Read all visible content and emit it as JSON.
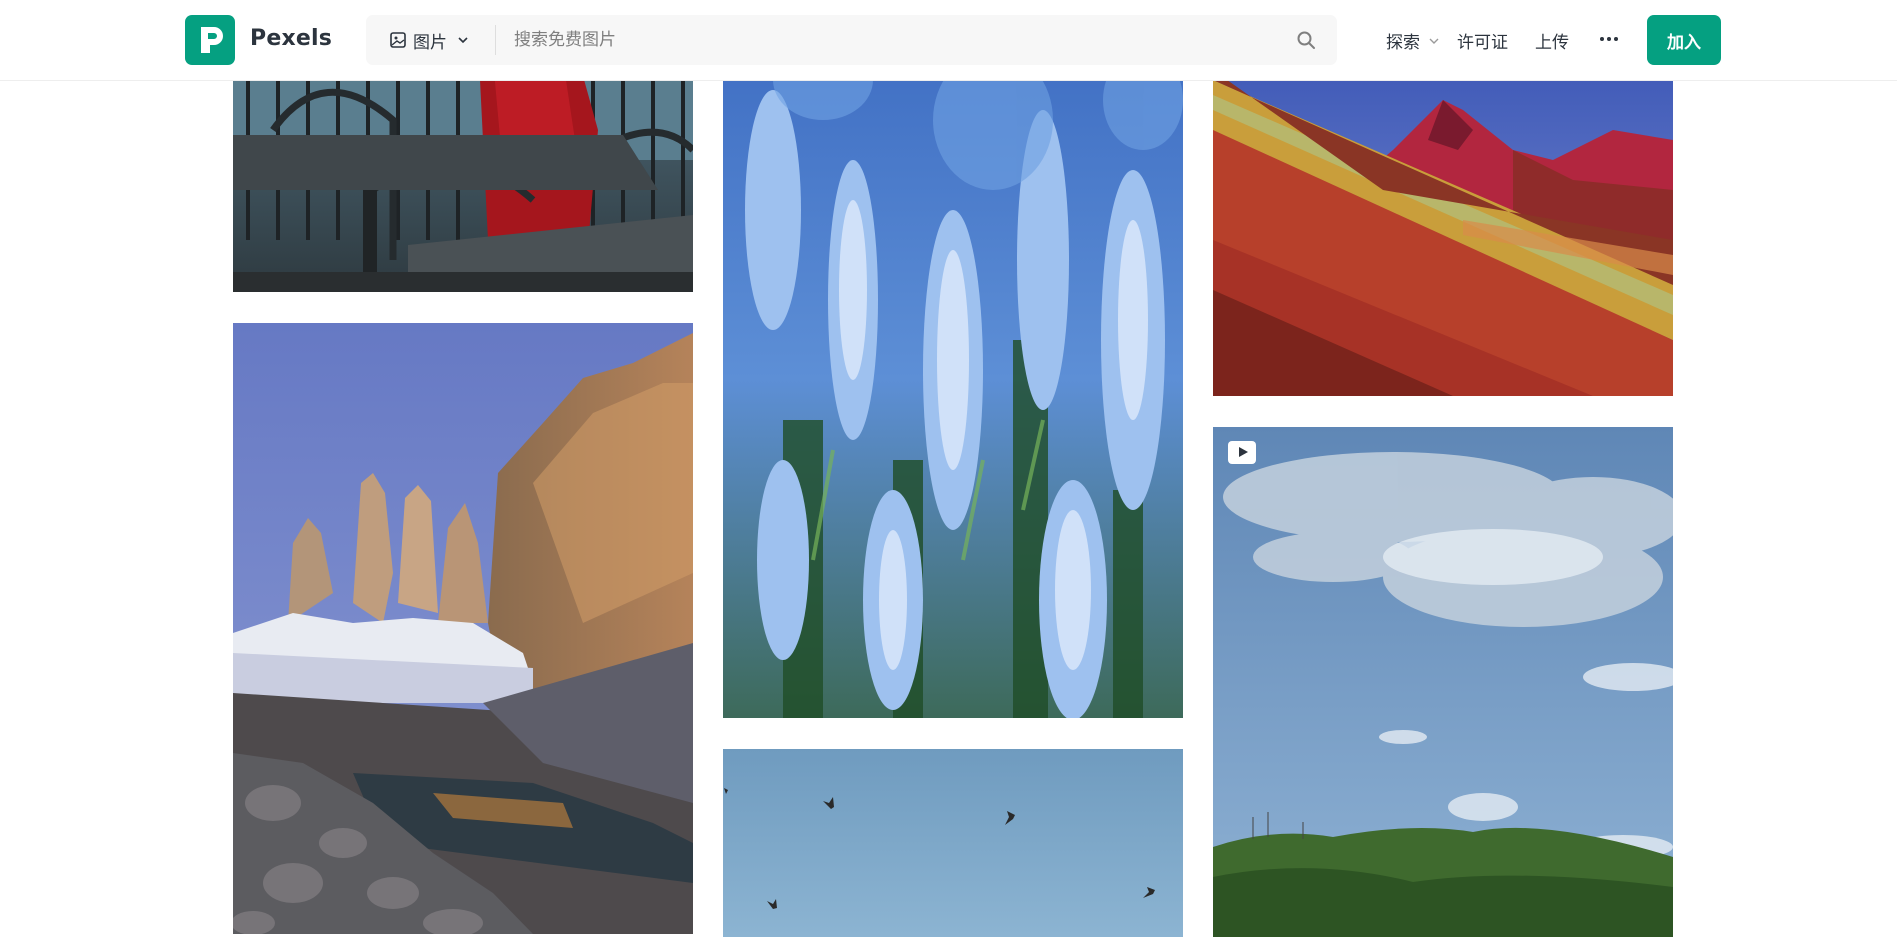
{
  "header": {
    "brand": "Pexels",
    "search": {
      "type_label": "图片",
      "placeholder": "搜索免费图片"
    },
    "nav": {
      "explore": "探索",
      "license": "许可证",
      "upload": "上传"
    },
    "join_label": "加入"
  },
  "photos": [
    {
      "name": "photo-cafe-table",
      "kind": "image"
    },
    {
      "name": "photo-lupine-flowers",
      "kind": "image"
    },
    {
      "name": "photo-rainbow-mountain",
      "kind": "image"
    },
    {
      "name": "photo-torres-del-paine",
      "kind": "image"
    },
    {
      "name": "photo-birds-sky",
      "kind": "image"
    },
    {
      "name": "photo-sky-hills",
      "kind": "video"
    }
  ],
  "icons": {
    "logo": "pexels-logo-icon",
    "search_type": "image-icon",
    "dropdown": "chevron-down-icon",
    "search": "search-icon",
    "more": "more-horizontal-icon",
    "video": "video-play-icon"
  },
  "colors": {
    "brand": "#05a081",
    "text": "#2c343e",
    "search_bg": "#f7f7f7"
  }
}
